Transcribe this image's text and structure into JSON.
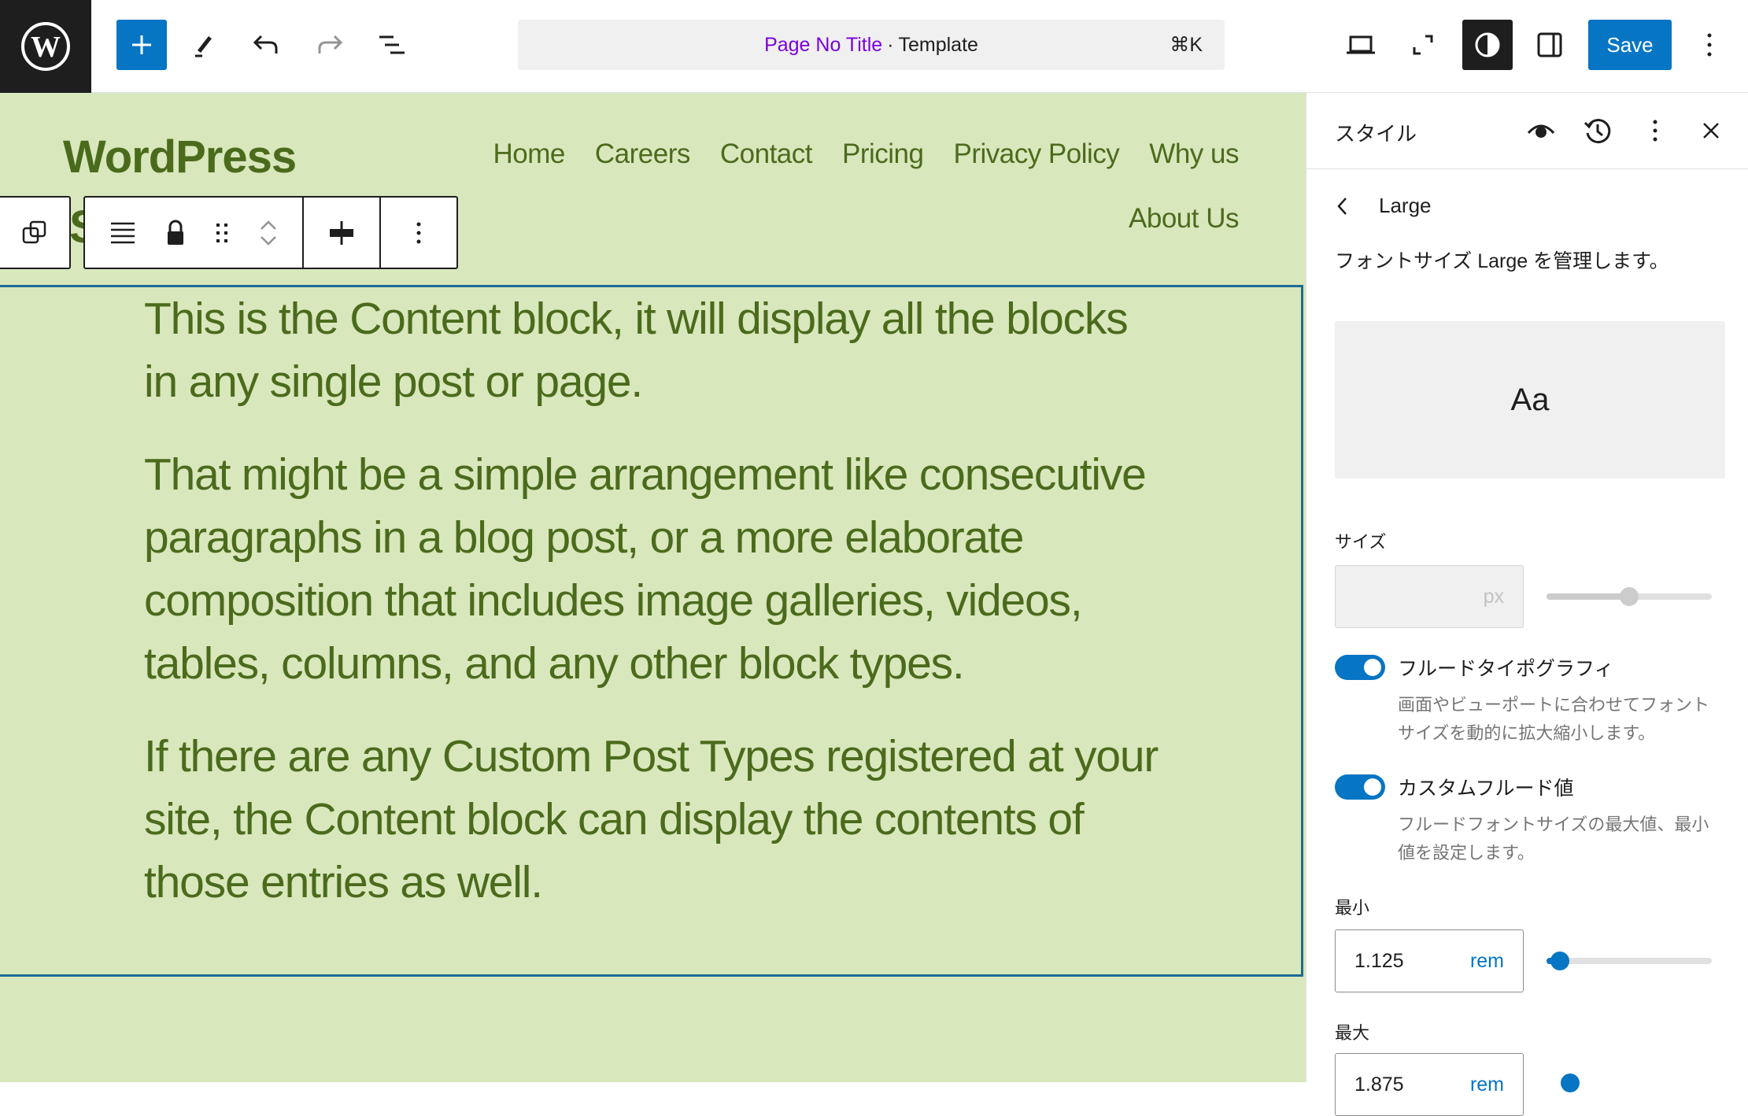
{
  "topbar": {
    "logo": "wordpress-logo",
    "add_block": "add-block",
    "tools": "edit-tool",
    "undo": "undo",
    "redo": "redo",
    "document_overview": "list-view",
    "command_bar": {
      "title": "Page No Title",
      "separator": "·",
      "type": "Template",
      "shortcut": "⌘K"
    },
    "view": "desktop-view",
    "fullscreen": "fullscreen",
    "styles": "styles-toggle",
    "settings": "settings-panel",
    "save_label": "Save",
    "options": "options-menu"
  },
  "canvas": {
    "site_title": "WordPress",
    "site_title_overflow_char": "S",
    "nav": [
      "Home",
      "Careers",
      "Contact",
      "Pricing",
      "Privacy Policy",
      "Why us",
      "About Us"
    ],
    "paragraphs": [
      "This is the Content block, it will display all the blocks in any single post or page.",
      "That might be a simple arrangement like consecutive paragraphs in a blog post, or a more elaborate composition that includes image galleries, videos, tables, columns, and any other block types.",
      "If there are any Custom Post Types registered at your site, the Content block can display the contents of those entries as well."
    ]
  },
  "sidebar": {
    "title": "スタイル",
    "nav_label": "Large",
    "description": "フォントサイズ Large を管理します。",
    "preview_text": "Aa",
    "size": {
      "label": "サイズ",
      "value": "",
      "unit": "px",
      "slider_value_fraction": 0.5
    },
    "fluid_typography": {
      "label": "フルードタイポグラフィ",
      "help": "画面やビューポートに合わせてフォントサイズを動的に拡大縮小します。",
      "checked": true
    },
    "custom_fluid": {
      "label": "カスタムフルード値",
      "help": "フルードフォントサイズの最大値、最小値を設定します。",
      "checked": true
    },
    "min": {
      "label": "最小",
      "value": "1.125",
      "unit": "rem",
      "slider_value_fraction": 0.08
    },
    "max": {
      "label": "最大",
      "value": "1.875",
      "unit": "rem"
    }
  },
  "colors": {
    "accent": "#0675c4",
    "canvas_bg": "#d9e7bd",
    "text_green": "#4b6b1c",
    "command_title": "#7a00df",
    "selection_border": "#1c6c94"
  }
}
